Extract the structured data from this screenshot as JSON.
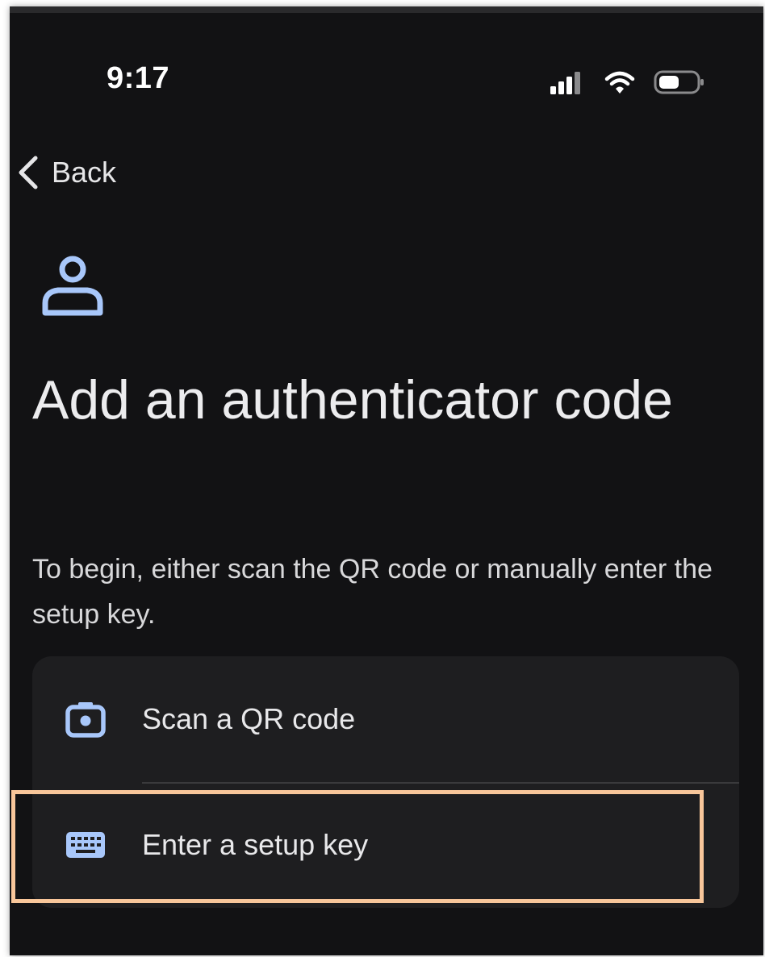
{
  "status_bar": {
    "time": "9:17",
    "icons": [
      "signal-icon",
      "wifi-icon",
      "battery-icon"
    ]
  },
  "nav": {
    "back_label": "Back",
    "back_icon": "chevron-left-icon"
  },
  "header": {
    "icon": "person-icon",
    "title": "Add an authenticator code"
  },
  "description": "To begin, either scan the QR code or manually enter the setup key.",
  "options": [
    {
      "label": "Scan a QR code",
      "icon": "camera-icon"
    },
    {
      "label": "Enter a setup key",
      "icon": "keyboard-icon"
    }
  ],
  "colors": {
    "background": "#121214",
    "card": "#1e1e20",
    "accent_icon": "#a8c7fa",
    "highlight_border": "#f8c69a",
    "text": "#ececee"
  }
}
